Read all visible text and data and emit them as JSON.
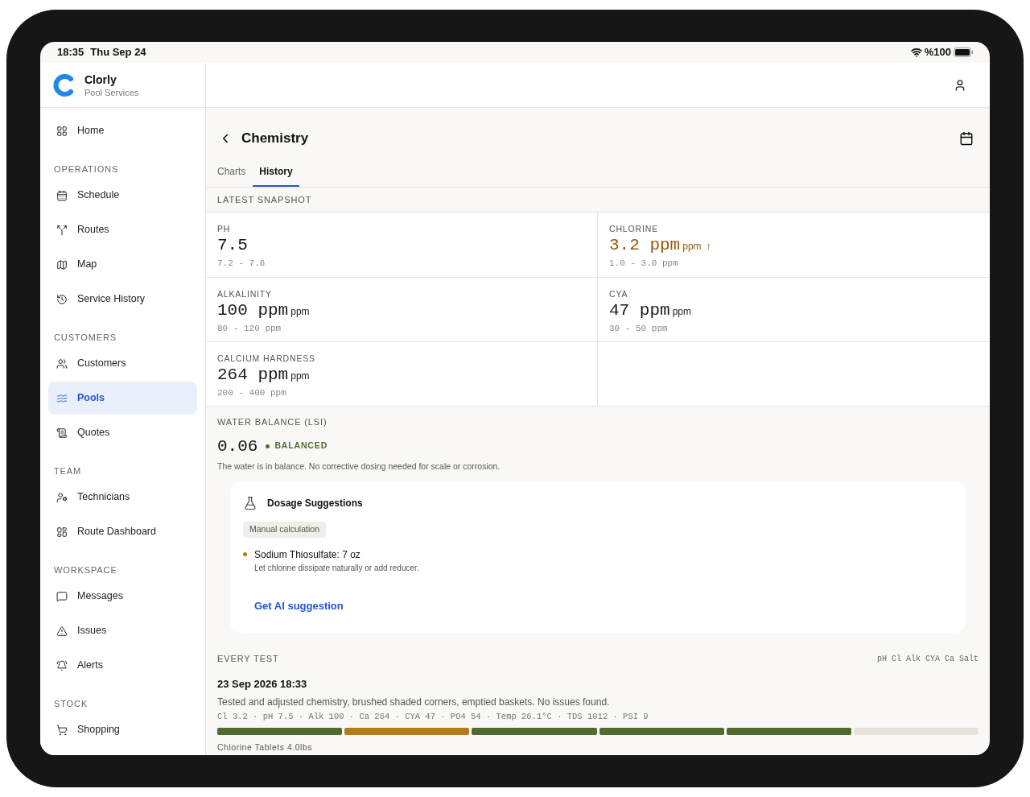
{
  "status_bar": {
    "time": "18:35",
    "date": "Thu Sep 24",
    "battery": "%100"
  },
  "brand": {
    "name": "Clorly",
    "subtitle": "Pool Services"
  },
  "sidebar": {
    "sections": [
      {
        "items": [
          {
            "label": "Home",
            "selected": false
          }
        ]
      },
      {
        "title": "OPERATIONS",
        "items": [
          {
            "label": "Schedule",
            "selected": false
          },
          {
            "label": "Routes",
            "selected": false
          },
          {
            "label": "Map",
            "selected": false
          },
          {
            "label": "Service History",
            "selected": false
          }
        ]
      },
      {
        "title": "CUSTOMERS",
        "items": [
          {
            "label": "Customers",
            "selected": false
          },
          {
            "label": "Pools",
            "selected": true
          },
          {
            "label": "Quotes",
            "selected": false
          }
        ]
      },
      {
        "title": "TEAM",
        "items": [
          {
            "label": "Technicians",
            "selected": false
          },
          {
            "label": "Route Dashboard",
            "selected": false
          }
        ]
      },
      {
        "title": "WORKSPACE",
        "items": [
          {
            "label": "Messages",
            "selected": false
          },
          {
            "label": "Issues",
            "selected": false
          },
          {
            "label": "Alerts",
            "selected": false
          }
        ]
      },
      {
        "title": "STOCK",
        "items": [
          {
            "label": "Shopping",
            "selected": false
          }
        ]
      }
    ]
  },
  "page": {
    "title": "Chemistry"
  },
  "tabs": [
    {
      "label": "Charts",
      "selected": false
    },
    {
      "label": "History",
      "selected": true
    }
  ],
  "snapshot": {
    "title": "LATEST SNAPSHOT",
    "metrics": [
      {
        "label": "PH",
        "value": "7.5",
        "range": "7.2 - 7.6",
        "out_of_range": false
      },
      {
        "label": "CHLORINE",
        "value": "3.2 ppm",
        "unit": "ppm",
        "trend": "↑",
        "range": "1.0 - 3.0 ppm",
        "out_of_range": true
      },
      {
        "label": "ALKALINITY",
        "value": "100 ppm",
        "unit": "ppm",
        "range": "80 - 120 ppm",
        "out_of_range": false
      },
      {
        "label": "CYA",
        "value": "47 ppm",
        "unit": "ppm",
        "range": "30 - 50 ppm",
        "out_of_range": false
      },
      {
        "label": "CALCIUM HARDNESS",
        "value": "264 ppm",
        "unit": "ppm",
        "range": "200 - 400 ppm",
        "out_of_range": false
      }
    ]
  },
  "water_balance": {
    "title": "WATER BALANCE (LSI)",
    "value": "0.06",
    "status": "BALANCED",
    "note": "The water is in balance. No corrective dosing needed for scale or corrosion."
  },
  "dosage": {
    "title": "Dosage Suggestions",
    "badge": "Manual calculation",
    "items": [
      {
        "title": "Sodium Thiosulfate: 7 oz",
        "note": "Let chlorine dissipate naturally or add reducer."
      }
    ],
    "action": "Get AI suggestion"
  },
  "every_test": {
    "title": "EVERY TEST",
    "legend": "pH Cl Alk CYA Ca Salt",
    "entries": [
      {
        "date": "23 Sep 2026 18:33",
        "note": "Tested and adjusted chemistry, brushed shaded corners, emptied baskets. No issues found.",
        "readings": "Cl 3.2 · pH 7.5 · Alk 100 · Ca 264 · CYA 47 · PO4 54 · Temp 26.1°C · TDS 1012 · PSI 9",
        "segments": [
          {
            "color": "#4f6b2f"
          },
          {
            "color": "#b57a1a"
          },
          {
            "color": "#4f6b2f"
          },
          {
            "color": "#4f6b2f"
          },
          {
            "color": "#4f6b2f"
          },
          {
            "color": "#e6e3dd"
          }
        ],
        "product": "Chlorine Tablets 4.0lbs"
      }
    ]
  }
}
